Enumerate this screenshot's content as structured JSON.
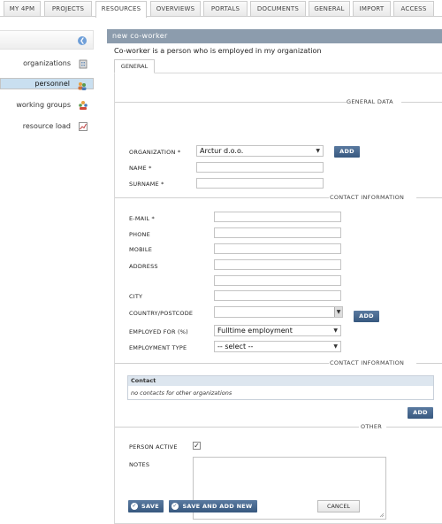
{
  "nav": {
    "tabs": [
      "MY 4PM",
      "PROJECTS",
      "RESOURCES",
      "OVERVIEWS",
      "PORTALS",
      "DOCUMENTS",
      "GENERAL",
      "IMPORT",
      "ACCESS"
    ]
  },
  "sidebar": {
    "items": [
      {
        "label": "organizations",
        "icon": "building-icon"
      },
      {
        "label": "personnel",
        "icon": "people-icon"
      },
      {
        "label": "working groups",
        "icon": "group-icon"
      },
      {
        "label": "resource load",
        "icon": "chart-icon"
      }
    ]
  },
  "main": {
    "title": "new co-worker",
    "subtitle": "Co-worker is a person who is employed in my organization",
    "form_tab": "GENERAL"
  },
  "general": {
    "section": "GENERAL DATA",
    "organization_label": "ORGANIZATION *",
    "organization_value": "Arctur d.o.o.",
    "add_label": "ADD",
    "name_label": "NAME *",
    "surname_label": "SURNAME *"
  },
  "contact": {
    "section": "CONTACT INFORMATION",
    "email_label": "E-MAIL *",
    "phone_label": "PHONE",
    "mobile_label": "MOBILE",
    "address_label": "ADDRESS",
    "city_label": "CITY",
    "country_label": "COUNTRY/POSTCODE",
    "add_label": "ADD",
    "employed_label": "EMPLOYED FOR (%)",
    "employed_value": "Fulltime employment",
    "type_label": "EMPLOYMENT TYPE",
    "type_value": "-- select --"
  },
  "contact2": {
    "section": "CONTACT INFORMATION",
    "table_header": "Contact",
    "empty_text": "no contacts for other organizations",
    "add_label": "ADD"
  },
  "other": {
    "section": "OTHER",
    "active_label": "PERSON ACTIVE",
    "notes_label": "NOTES"
  },
  "footer": {
    "save": "SAVE",
    "save_add": "SAVE AND ADD NEW",
    "cancel": "CANCEL"
  }
}
